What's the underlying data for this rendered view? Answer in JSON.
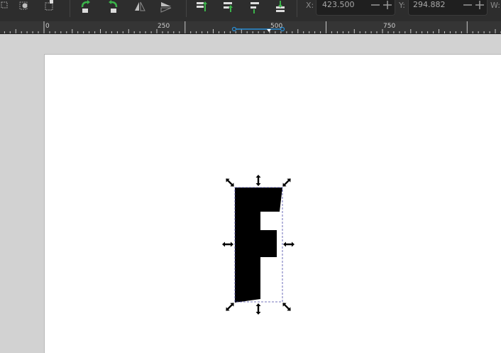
{
  "coords": {
    "x_label": "X:",
    "x_value": "423.500",
    "y_label": "Y:",
    "y_value": "294.882",
    "w_label": "W:"
  },
  "ruler": {
    "labels": [
      "0",
      "250",
      "500",
      "750"
    ]
  },
  "canvas": {
    "glyph": "F",
    "glyph_color": "#000000",
    "selection_color": "#4a4aa8"
  },
  "icons": {
    "toolbar": [
      "select-same-icon",
      "select-rect-icon",
      "rotate-ccw-icon",
      "rotate-cw-icon",
      "flip-horizontal-icon",
      "flip-vertical-icon",
      "raise-to-top-icon",
      "raise-icon",
      "lower-icon",
      "lower-to-bottom-icon"
    ]
  },
  "colors": {
    "toolbar_bg": "#2d2d2d",
    "accent_green": "#3bb34a",
    "ruler_bg": "#353535",
    "canvas_bg": "#d2d2d2",
    "page_bg": "#ffffff",
    "ruler_marker": "#2a8fd6"
  }
}
